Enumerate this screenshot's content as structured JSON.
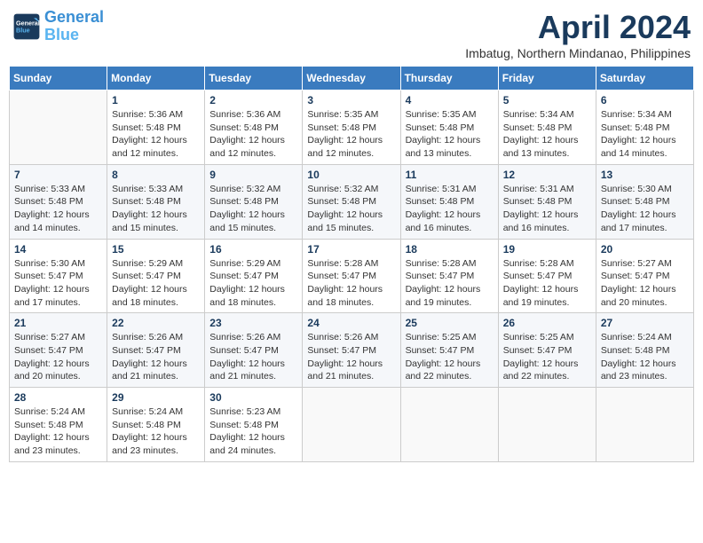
{
  "header": {
    "logo_line1": "General",
    "logo_line2": "Blue",
    "month": "April 2024",
    "location": "Imbatug, Northern Mindanao, Philippines"
  },
  "weekdays": [
    "Sunday",
    "Monday",
    "Tuesday",
    "Wednesday",
    "Thursday",
    "Friday",
    "Saturday"
  ],
  "weeks": [
    [
      {
        "day": "",
        "info": ""
      },
      {
        "day": "1",
        "info": "Sunrise: 5:36 AM\nSunset: 5:48 PM\nDaylight: 12 hours\nand 12 minutes."
      },
      {
        "day": "2",
        "info": "Sunrise: 5:36 AM\nSunset: 5:48 PM\nDaylight: 12 hours\nand 12 minutes."
      },
      {
        "day": "3",
        "info": "Sunrise: 5:35 AM\nSunset: 5:48 PM\nDaylight: 12 hours\nand 12 minutes."
      },
      {
        "day": "4",
        "info": "Sunrise: 5:35 AM\nSunset: 5:48 PM\nDaylight: 12 hours\nand 13 minutes."
      },
      {
        "day": "5",
        "info": "Sunrise: 5:34 AM\nSunset: 5:48 PM\nDaylight: 12 hours\nand 13 minutes."
      },
      {
        "day": "6",
        "info": "Sunrise: 5:34 AM\nSunset: 5:48 PM\nDaylight: 12 hours\nand 14 minutes."
      }
    ],
    [
      {
        "day": "7",
        "info": "Sunrise: 5:33 AM\nSunset: 5:48 PM\nDaylight: 12 hours\nand 14 minutes."
      },
      {
        "day": "8",
        "info": "Sunrise: 5:33 AM\nSunset: 5:48 PM\nDaylight: 12 hours\nand 15 minutes."
      },
      {
        "day": "9",
        "info": "Sunrise: 5:32 AM\nSunset: 5:48 PM\nDaylight: 12 hours\nand 15 minutes."
      },
      {
        "day": "10",
        "info": "Sunrise: 5:32 AM\nSunset: 5:48 PM\nDaylight: 12 hours\nand 15 minutes."
      },
      {
        "day": "11",
        "info": "Sunrise: 5:31 AM\nSunset: 5:48 PM\nDaylight: 12 hours\nand 16 minutes."
      },
      {
        "day": "12",
        "info": "Sunrise: 5:31 AM\nSunset: 5:48 PM\nDaylight: 12 hours\nand 16 minutes."
      },
      {
        "day": "13",
        "info": "Sunrise: 5:30 AM\nSunset: 5:48 PM\nDaylight: 12 hours\nand 17 minutes."
      }
    ],
    [
      {
        "day": "14",
        "info": "Sunrise: 5:30 AM\nSunset: 5:47 PM\nDaylight: 12 hours\nand 17 minutes."
      },
      {
        "day": "15",
        "info": "Sunrise: 5:29 AM\nSunset: 5:47 PM\nDaylight: 12 hours\nand 18 minutes."
      },
      {
        "day": "16",
        "info": "Sunrise: 5:29 AM\nSunset: 5:47 PM\nDaylight: 12 hours\nand 18 minutes."
      },
      {
        "day": "17",
        "info": "Sunrise: 5:28 AM\nSunset: 5:47 PM\nDaylight: 12 hours\nand 18 minutes."
      },
      {
        "day": "18",
        "info": "Sunrise: 5:28 AM\nSunset: 5:47 PM\nDaylight: 12 hours\nand 19 minutes."
      },
      {
        "day": "19",
        "info": "Sunrise: 5:28 AM\nSunset: 5:47 PM\nDaylight: 12 hours\nand 19 minutes."
      },
      {
        "day": "20",
        "info": "Sunrise: 5:27 AM\nSunset: 5:47 PM\nDaylight: 12 hours\nand 20 minutes."
      }
    ],
    [
      {
        "day": "21",
        "info": "Sunrise: 5:27 AM\nSunset: 5:47 PM\nDaylight: 12 hours\nand 20 minutes."
      },
      {
        "day": "22",
        "info": "Sunrise: 5:26 AM\nSunset: 5:47 PM\nDaylight: 12 hours\nand 21 minutes."
      },
      {
        "day": "23",
        "info": "Sunrise: 5:26 AM\nSunset: 5:47 PM\nDaylight: 12 hours\nand 21 minutes."
      },
      {
        "day": "24",
        "info": "Sunrise: 5:26 AM\nSunset: 5:47 PM\nDaylight: 12 hours\nand 21 minutes."
      },
      {
        "day": "25",
        "info": "Sunrise: 5:25 AM\nSunset: 5:47 PM\nDaylight: 12 hours\nand 22 minutes."
      },
      {
        "day": "26",
        "info": "Sunrise: 5:25 AM\nSunset: 5:47 PM\nDaylight: 12 hours\nand 22 minutes."
      },
      {
        "day": "27",
        "info": "Sunrise: 5:24 AM\nSunset: 5:48 PM\nDaylight: 12 hours\nand 23 minutes."
      }
    ],
    [
      {
        "day": "28",
        "info": "Sunrise: 5:24 AM\nSunset: 5:48 PM\nDaylight: 12 hours\nand 23 minutes."
      },
      {
        "day": "29",
        "info": "Sunrise: 5:24 AM\nSunset: 5:48 PM\nDaylight: 12 hours\nand 23 minutes."
      },
      {
        "day": "30",
        "info": "Sunrise: 5:23 AM\nSunset: 5:48 PM\nDaylight: 12 hours\nand 24 minutes."
      },
      {
        "day": "",
        "info": ""
      },
      {
        "day": "",
        "info": ""
      },
      {
        "day": "",
        "info": ""
      },
      {
        "day": "",
        "info": ""
      }
    ]
  ]
}
